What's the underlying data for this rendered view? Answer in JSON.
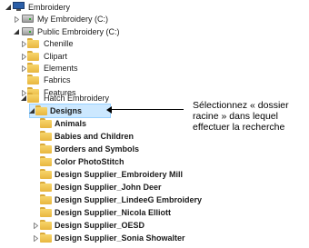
{
  "tree": {
    "root": "Embroidery",
    "my_embroidery": "My Embroidery (C:)",
    "public_embroidery": "Public Embroidery (C:)",
    "chenille": "Chenille",
    "clipart": "Clipart",
    "elements": "Elements",
    "fabrics": "Fabrics",
    "features": "Features",
    "hatch": "Hatch Embroidery",
    "designs": "Designs",
    "animals": "Animals",
    "babies": "Babies and Children",
    "borders": "Borders and Symbols",
    "color_photostitch": "Color PhotoStitch",
    "ds_embroidery_mill": "Design Supplier_Embroidery Mill",
    "ds_john_deer": "Design Supplier_John Deer",
    "ds_lindeeg": "Design Supplier_LindeeG Embroidery",
    "ds_nicola": "Design Supplier_Nicola Elliott",
    "ds_oesd": "Design Supplier_OESD",
    "ds_sonia": "Design Supplier_Sonia Showalter"
  },
  "callout": {
    "line1": "Sélectionnez « dossier",
    "line2": "racine » dans lequel",
    "line3": "effectuer la recherche"
  },
  "colors": {
    "selection": "#cce8ff",
    "folder": "#f0c24e"
  }
}
